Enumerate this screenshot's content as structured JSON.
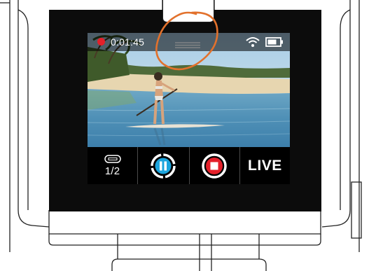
{
  "status_bar": {
    "recording_indicator_color": "#e4202a",
    "elapsed_time": "0:01:45",
    "wifi_icon": "wifi-icon",
    "battery_icon": "battery-icon",
    "menu_icon": "menu-handle-icon"
  },
  "preview": {
    "scene": "paddleboarder on a tropical beach"
  },
  "controls": {
    "storage": {
      "icon": "sd-card-icon",
      "value": "1/2"
    },
    "pause_button": {
      "icon": "pause-icon",
      "color": "#1ba4dd"
    },
    "stop_button": {
      "icon": "stop-icon",
      "color": "#e4202a"
    },
    "live_label": "LIVE"
  },
  "annotation": {
    "highlight_color": "#e2712c"
  }
}
